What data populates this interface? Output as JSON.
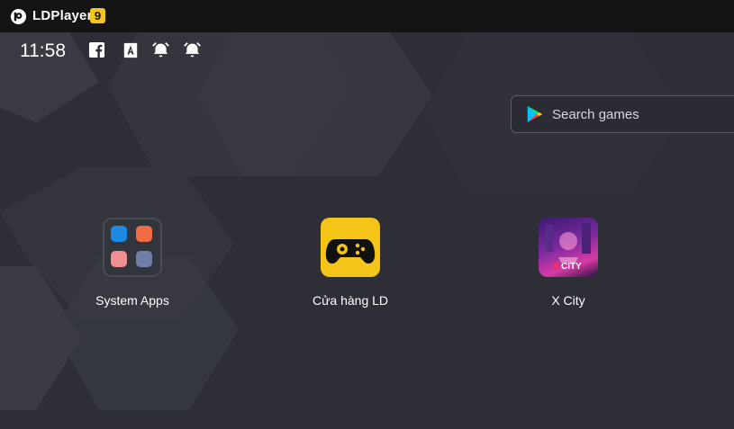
{
  "window": {
    "title": "LDPlayer",
    "version_badge": "9"
  },
  "status_bar": {
    "time": "11:58",
    "icons": [
      "facebook-icon",
      "a-notification-icon",
      "alarm-icon",
      "alarm-icon"
    ]
  },
  "search": {
    "placeholder": "Search games"
  },
  "apps": [
    {
      "label": "System Apps",
      "icon": "system-apps-folder-icon"
    },
    {
      "label": "Cửa hàng LD",
      "icon": "ld-store-gamepad-icon"
    },
    {
      "label": "X City",
      "icon": "x-city-game-icon",
      "icon_text": "CITY"
    }
  ],
  "colors": {
    "titlebar": "#141414",
    "desktop": "#2e2f36",
    "accent_yellow": "#f4c418"
  }
}
